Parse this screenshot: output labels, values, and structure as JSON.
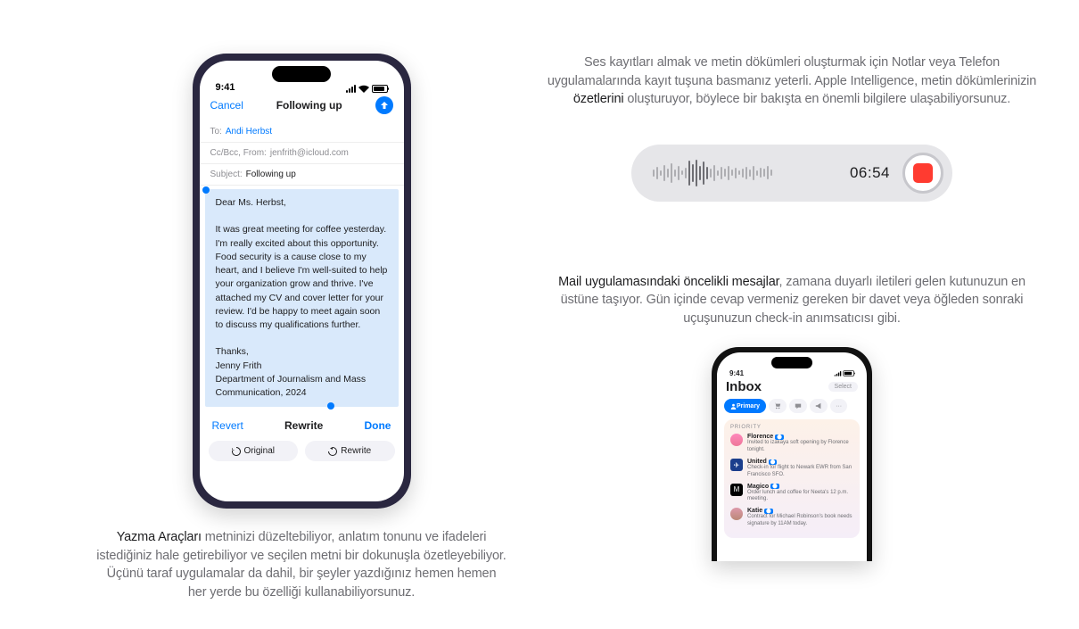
{
  "left": {
    "phone": {
      "time": "9:41",
      "nav": {
        "cancel": "Cancel",
        "title": "Following up"
      },
      "to_label": "To:",
      "to_value": "Andi Herbst",
      "cc_label": "Cc/Bcc, From:",
      "cc_value": "jenfrith@icloud.com",
      "subject_label": "Subject:",
      "subject_value": "Following up",
      "body": "Dear Ms. Herbst,\n\nIt was great meeting for coffee yesterday. I'm really excited about this opportunity. Food security is a cause close to my heart, and I believe I'm well-suited to help your organization grow and thrive. I've attached my CV and cover letter for your review. I'd be happy to meet again soon to discuss my qualifications further.\n\nThanks,\nJenny Frith\nDepartment of Journalism and Mass Communication, 2024",
      "toolbar": {
        "revert": "Revert",
        "rewrite": "Rewrite",
        "done": "Done"
      },
      "pills": {
        "original": "Original",
        "rewrite": "Rewrite"
      }
    },
    "caption_strong": "Yazma Araçları",
    "caption_rest": " metninizi düzeltebiliyor, anlatım tonunu ve ifadeleri istediğiniz hale getirebiliyor ve seçilen metni bir dokunuşla özetleyebiliyor. Üçünü taraf uygulamalar da dahil, bir şeyler yazdığınız hemen hemen her yerde bu özelliği kullanabiliyorsunuz."
  },
  "right": {
    "caption1_a": "Ses kayıtları almak ve metin dökümleri oluşturmak için Notlar veya Telefon uygulamalarında kayıt tuşuna basmanız yeterli. Apple Intelligence, metin dökümlerinizin ",
    "caption1_strong": "özetlerini",
    "caption1_b": " oluşturuyor, böylece bir bakışta en önemli bilgilere ulaşabiliyorsunuz.",
    "audio": {
      "timer": "06:54"
    },
    "caption2_strong": "Mail uygulamasındaki öncelikli mesajlar",
    "caption2_rest": ", zamana duyarlı iletileri gelen kutunuzun en üstüne taşıyor. Gün içinde cevap vermeniz gereken bir davet veya öğleden sonraki uçuşunuzun check-in anımsatıcısı gibi.",
    "inbox": {
      "time": "9:41",
      "title": "Inbox",
      "select": "Select",
      "primary_tab": "Primary",
      "priority_label": "PRIORITY",
      "messages": [
        {
          "sender": "Florence",
          "text": "Invited to izakaya soft opening by Florence tonight."
        },
        {
          "sender": "United",
          "text": "Check-in for flight to Newark EWR from San Francisco SFO."
        },
        {
          "sender": "Magico",
          "text": "Order lunch and coffee for Neeta's 12 p.m. meeting."
        },
        {
          "sender": "Katie",
          "text": "Contract for Michael Robinson's book needs signature by 11AM today."
        }
      ]
    }
  }
}
